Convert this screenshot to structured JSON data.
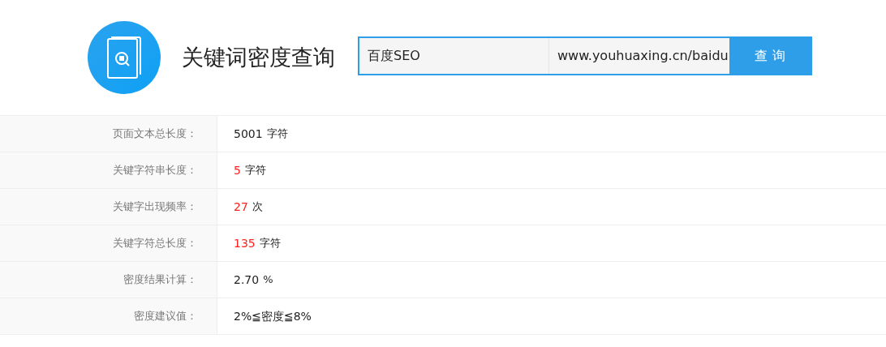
{
  "header": {
    "title": "关键词密度查询"
  },
  "search": {
    "keyword": "百度SEO",
    "url": "www.youhuaxing.cn/baidu",
    "button": "查 询"
  },
  "results": [
    {
      "label": "页面文本总长度：",
      "value": "5001",
      "unit": "字符",
      "highlighted": false
    },
    {
      "label": "关键字符串长度：",
      "value": "5",
      "unit": "字符",
      "highlighted": true
    },
    {
      "label": "关键字出现频率：",
      "value": "27",
      "unit": "次",
      "highlighted": true
    },
    {
      "label": "关键字符总长度：",
      "value": "135",
      "unit": "字符",
      "highlighted": true
    },
    {
      "label": "密度结果计算：",
      "value": "2.70",
      "unit": "%",
      "highlighted": false
    },
    {
      "label": "密度建议值：",
      "value": "2%≦密度≦8%",
      "highlighted": false
    }
  ]
}
